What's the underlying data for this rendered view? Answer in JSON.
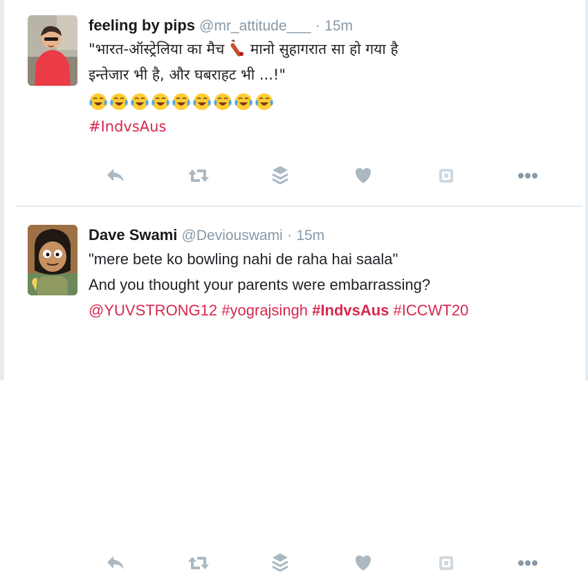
{
  "tweets": [
    {
      "name": "feeling by pips",
      "handle": "@mr_attitude___",
      "separator": "·",
      "time": "15m",
      "lines": {
        "line1a": "\"भारत-ऑस्ट्रेलिया का मैच",
        "line1b": "मानो सुहागरात सा हो गया है",
        "line2": "इन्तेजार भी है, और घबराहट भी ...!\""
      },
      "emoji_count": 9,
      "emoji_icon": "crying-laughing-face-icon",
      "hashtags": [
        "#IndvsAus"
      ]
    },
    {
      "name": "Dave Swami",
      "handle": "@Deviouswami",
      "separator": "·",
      "time": "15m",
      "lines": {
        "line1": "\"mere bete ko bowling nahi de raha hai saala\"",
        "line2": "And you thought your parents were embarrassing?"
      },
      "tags": {
        "mention": "@YUVSTRONG12",
        "tag1": "#yograjsingh",
        "tag2": "#IndvsAus",
        "tag3": "#ICCWT20"
      }
    }
  ],
  "actions": [
    "reply-icon",
    "retweet-icon",
    "buffer-icon",
    "like-icon",
    "pocket-icon",
    "more-icon"
  ],
  "colors": {
    "hashtag": "#d6284f",
    "icon": "#aab8c2",
    "meta": "#8899a6"
  }
}
